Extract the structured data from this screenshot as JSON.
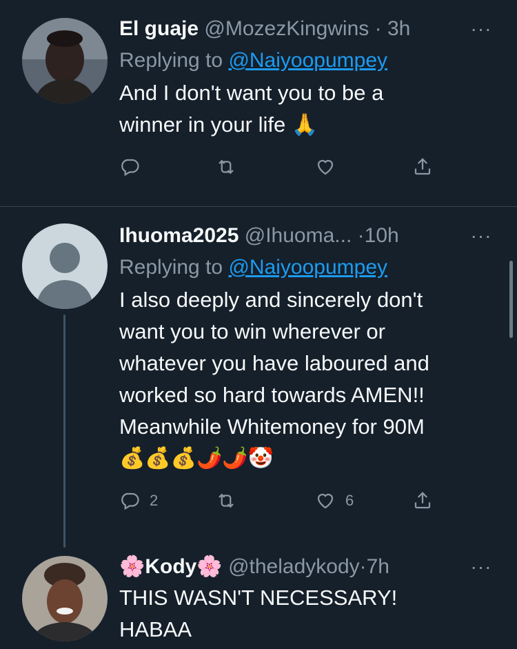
{
  "tweets": [
    {
      "name": "El guaje",
      "handle": "@MozezKingwins",
      "dot": "·",
      "time": "3h",
      "reply_prefix": "Replying to ",
      "reply_handle": "@Naiyoopumpey",
      "text_lines": [
        "And I don't want you to be a",
        "winner in your life 🙏"
      ],
      "reply_count": "",
      "retweet_count": "",
      "like_count": ""
    },
    {
      "name": "Ihuoma2025",
      "handle": "@Ihuoma...",
      "dot": "·",
      "time": "10h",
      "reply_prefix": "Replying to ",
      "reply_handle": "@Naiyoopumpey",
      "text_lines": [
        "I also deeply and sincerely don't",
        "want you to win wherever or",
        "whatever you have laboured and",
        "worked so hard towards AMEN!!",
        "Meanwhile Whitemoney for 90M",
        "💰💰💰🌶️🌶️🤡"
      ],
      "reply_count": "2",
      "retweet_count": "",
      "like_count": "6"
    },
    {
      "name": "🌸Kody🌸",
      "handle": "@theladykody",
      "dot": "·",
      "time": "7h",
      "text_lines": [
        "THIS WASN'T NECESSARY!",
        "HABAA"
      ]
    }
  ],
  "more_icon": "···",
  "colors": {
    "background": "#15202b",
    "text": "#f7f9f9",
    "secondary": "#8b98a5",
    "link": "#1d9bf0",
    "divider": "#38444d"
  }
}
